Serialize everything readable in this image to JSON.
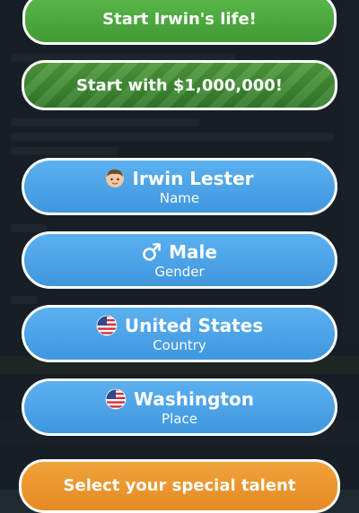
{
  "actions": {
    "start_life": "Start Irwin's life!",
    "start_money": "Start with $1,000,000!",
    "special_talent": "Select your special talent"
  },
  "fields": [
    {
      "key": "name",
      "value": "Irwin Lester",
      "label": "Name",
      "icon": "person-icon"
    },
    {
      "key": "gender",
      "value": "Male",
      "label": "Gender",
      "icon": "male-symbol-icon"
    },
    {
      "key": "country",
      "value": "United States",
      "label": "Country",
      "icon": "us-flag-icon"
    },
    {
      "key": "place",
      "value": "Washington",
      "label": "Place",
      "icon": "us-flag-icon"
    }
  ],
  "colors": {
    "green": "#4caf3f",
    "blue": "#4aa3e8",
    "orange": "#ee9a30",
    "border": "#ffffff"
  }
}
